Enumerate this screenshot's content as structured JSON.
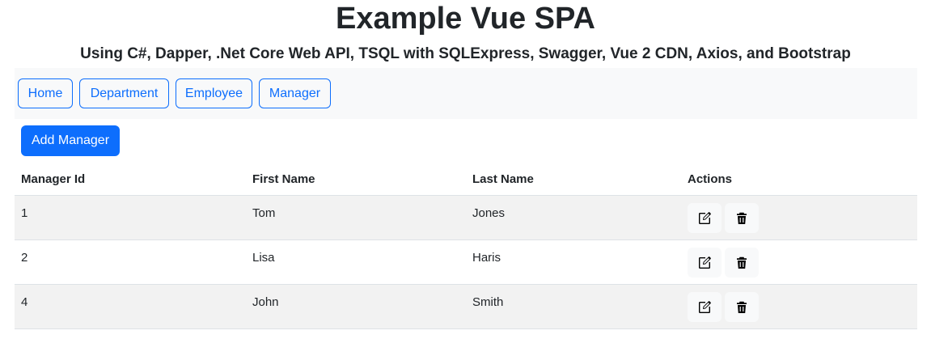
{
  "header": {
    "title": "Example Vue SPA",
    "subtitle": "Using C#, Dapper, .Net Core Web API, TSQL with SQLExpress, Swagger, Vue 2 CDN, Axios, and Bootstrap"
  },
  "nav": {
    "items": [
      {
        "label": "Home"
      },
      {
        "label": "Department"
      },
      {
        "label": "Employee"
      },
      {
        "label": "Manager"
      }
    ]
  },
  "toolbar": {
    "add_label": "Add Manager"
  },
  "table": {
    "columns": [
      "Manager Id",
      "First Name",
      "Last Name",
      "Actions"
    ],
    "rows": [
      {
        "id": "1",
        "first_name": "Tom",
        "last_name": "Jones"
      },
      {
        "id": "2",
        "first_name": "Lisa",
        "last_name": "Haris"
      },
      {
        "id": "4",
        "first_name": "John",
        "last_name": "Smith"
      }
    ],
    "row_actions": [
      "edit-icon",
      "trash-icon"
    ]
  },
  "colors": {
    "primary": "#0d6efd",
    "text": "#212529",
    "navbar_bg": "#f8f9fa",
    "stripe": "#f2f2f2"
  }
}
